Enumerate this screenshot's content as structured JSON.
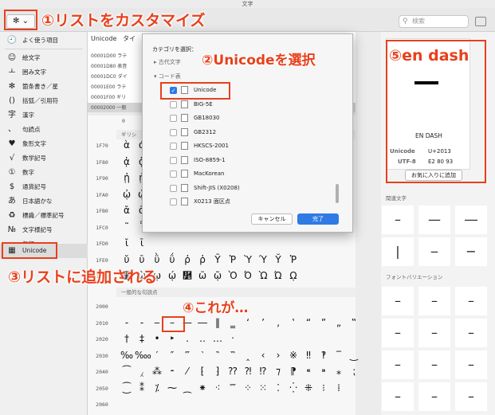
{
  "window": {
    "title": "文字"
  },
  "toolbar": {
    "gear": "✻ ⌄",
    "search_placeholder": "検索"
  },
  "annotations": {
    "a1": "①リストをカスタマイズ",
    "a2": "②Unicodeを選択",
    "a3": "③リストに追加される",
    "a4": "④これが…",
    "a5": "⑤en dash"
  },
  "sidebar": {
    "items": [
      {
        "icon": "🕘",
        "label": "よく使う項目"
      },
      {
        "icon": "☺",
        "label": "絵文字"
      },
      {
        "icon": "ㅗ",
        "label": "囲み文字"
      },
      {
        "icon": "✻",
        "label": "箇条書き／星"
      },
      {
        "icon": "()",
        "label": "括弧／引用符"
      },
      {
        "icon": "字",
        "label": "漢字"
      },
      {
        "icon": "、",
        "label": "句読点"
      },
      {
        "icon": "♥",
        "label": "象形文字"
      },
      {
        "icon": "√",
        "label": "数学記号"
      },
      {
        "icon": "①",
        "label": "数字"
      },
      {
        "icon": "$",
        "label": "通貨記号"
      },
      {
        "icon": "あ",
        "label": "日本語かな"
      },
      {
        "icon": "♻",
        "label": "標識／標準記号"
      },
      {
        "icon": "№",
        "label": "文字様記号"
      },
      {
        "icon": "→",
        "label": "矢印"
      },
      {
        "icon": "▦",
        "label": "Unicode"
      }
    ]
  },
  "list": {
    "header": [
      "Unicode",
      "タイ"
    ],
    "rows": [
      "00001D00 ラテ",
      "00001D80 表音",
      "00001DC0 ダイ",
      "00001E00 ラテ",
      "00001F00 ギリ",
      "00002000 一般"
    ]
  },
  "grid": {
    "col_header": "0",
    "section1": "ギリシ",
    "rows1": [
      {
        "label": "1F70",
        "chars": [
          "ὰ",
          "ά"
        ]
      },
      {
        "label": "1F80",
        "chars": [
          "ᾀ",
          "ᾁ"
        ]
      },
      {
        "label": "1F90",
        "chars": [
          "ᾐ",
          "ᾑ"
        ]
      },
      {
        "label": "1FA0",
        "chars": [
          "ᾠ",
          "ᾡ"
        ]
      },
      {
        "label": "1FB0",
        "chars": [
          "ᾰ",
          "ᾱ"
        ]
      },
      {
        "label": "1FC0",
        "chars": [
          "῀",
          "῁"
        ]
      },
      {
        "label": "1FD0",
        "chars": [
          "ῐ",
          "ῑ"
        ]
      },
      {
        "label": "1FE0",
        "chars": [
          "ῠ",
          "ῡ",
          "ῢ",
          "ΰ",
          "ῤ",
          "ῥ",
          "Ῡ",
          "Ῥ",
          "Ὺ",
          "Ύ",
          "Ῠ",
          "Ῥ"
        ]
      },
      {
        "label": "1FF0",
        "chars": [
          "῰",
          "ῲ",
          "ῳ",
          "ῴ",
          "῵",
          "ῶ",
          "ῷ",
          "Ὸ",
          "Ό",
          "Ὼ",
          "Ώ",
          "ῼ"
        ]
      }
    ],
    "section2": "一般的な句読点",
    "rows2": [
      {
        "label": "2000",
        "chars": [
          " ",
          " ",
          " ",
          " ",
          " ",
          " ",
          " ",
          " ",
          " ",
          " ",
          " "
        ]
      },
      {
        "label": "2010",
        "chars": [
          "‐",
          "‑",
          "‒",
          "–",
          "—",
          "―",
          "‖",
          "‗",
          "‘",
          "’",
          "‚",
          "‛",
          "“",
          "”",
          "„",
          "‟"
        ]
      },
      {
        "label": "2020",
        "chars": [
          "†",
          "‡",
          "•",
          "‣",
          "․",
          "‥",
          "…",
          "‧"
        ]
      },
      {
        "label": "2030",
        "chars": [
          "‰",
          "‱",
          "′",
          "″",
          "‴",
          "‵",
          "‶",
          "‷",
          "‸",
          "‹",
          "›",
          "※",
          "‼",
          "‽",
          "‾",
          "‿"
        ]
      },
      {
        "label": "2040",
        "chars": [
          "⁀",
          "⁁",
          "⁂",
          "⁃",
          "⁄",
          "⁅",
          "⁆",
          "⁇",
          "⁈",
          "⁉",
          "⁊",
          "⁋",
          "⁌",
          "⁍",
          "⁎",
          "⁏"
        ]
      },
      {
        "label": "2050",
        "chars": [
          "⁐",
          "⁑",
          "⁒",
          "⁓",
          "⁔",
          "⁕",
          "⁖",
          "⁗",
          "⁘",
          "⁙",
          "⁚",
          "⁛",
          "⁜",
          "⁝",
          "⁞"
        ]
      },
      {
        "label": "2060",
        "chars": []
      }
    ]
  },
  "dialog": {
    "prompt": "カテゴリを選択：",
    "group_ancient": "▸ 古代文字",
    "group_code": "▾ コード表",
    "items": [
      {
        "label": "Unicode",
        "checked": true
      },
      {
        "label": "BIG-5E",
        "checked": false
      },
      {
        "label": "GB18030",
        "checked": false
      },
      {
        "label": "GB2312",
        "checked": false
      },
      {
        "label": "HKSCS-2001",
        "checked": false
      },
      {
        "label": "ISO-8859-1",
        "checked": false
      },
      {
        "label": "MacKorean",
        "checked": false
      },
      {
        "label": "Shift-JIS (X0208)",
        "checked": false
      },
      {
        "label": "X0213 面区点",
        "checked": false
      }
    ],
    "cancel": "キャンセル",
    "done": "完了"
  },
  "right_panel": {
    "glyph": "—",
    "name": "EN DASH",
    "unicode_label": "Unicode",
    "unicode_value": "U+2013",
    "utf8_label": "UTF-8",
    "utf8_value": "E2 80 93",
    "fav_button": "お気に入りに追加",
    "related_title": "関連文字",
    "font_var_title": "フォントバリエーション"
  },
  "colors": {
    "accent": "#e8401c",
    "blue": "#2f7ae5"
  }
}
